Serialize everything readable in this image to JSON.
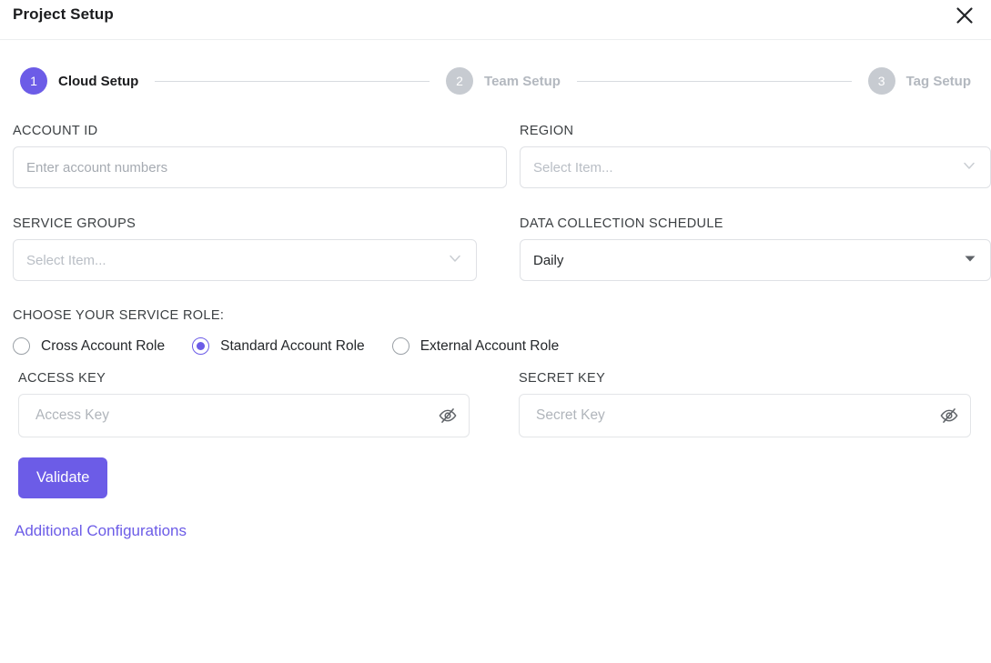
{
  "header": {
    "title": "Project Setup",
    "close_icon": "close-icon"
  },
  "stepper": {
    "steps": [
      {
        "number": "1",
        "label": "Cloud Setup",
        "state": "active"
      },
      {
        "number": "2",
        "label": "Team Setup",
        "state": "inactive"
      },
      {
        "number": "3",
        "label": "Tag Setup",
        "state": "inactive"
      }
    ]
  },
  "form": {
    "account_id": {
      "label": "ACCOUNT ID",
      "placeholder": "Enter account numbers",
      "value": ""
    },
    "region": {
      "label": "REGION",
      "placeholder": "Select Item...",
      "value": "",
      "icon": "chevron-down-icon"
    },
    "service_groups": {
      "label": "SERVICE GROUPS",
      "placeholder": "Select Item...",
      "value": "",
      "icon": "chevron-down-icon"
    },
    "data_collection_schedule": {
      "label": "DATA COLLECTION SCHEDULE",
      "value": "Daily",
      "icon": "caret-down-icon"
    },
    "service_role": {
      "label": "CHOOSE YOUR SERVICE ROLE:",
      "options": [
        {
          "label": "Cross Account Role",
          "selected": false
        },
        {
          "label": "Standard Account Role",
          "selected": true
        },
        {
          "label": "External Account Role",
          "selected": false
        }
      ]
    },
    "access_key": {
      "label": "ACCESS KEY",
      "placeholder": "Access Key",
      "value": "",
      "toggle_icon": "eye-off-icon"
    },
    "secret_key": {
      "label": "SECRET KEY",
      "placeholder": "Secret Key",
      "value": "",
      "toggle_icon": "eye-off-icon"
    },
    "validate_button": "Validate",
    "additional_configurations_link": "Additional Configurations"
  },
  "colors": {
    "accent": "#6c5ce7",
    "inactive_step": "#c7cbd1",
    "border": "#dfe1e5",
    "placeholder": "#b0b5bb",
    "text": "#25282b"
  }
}
